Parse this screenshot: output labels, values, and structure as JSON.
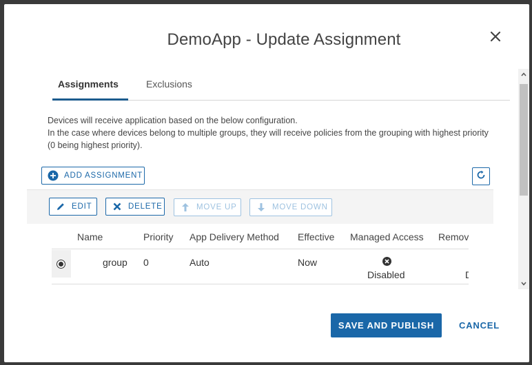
{
  "dialog": {
    "title": "DemoApp - Update Assignment"
  },
  "tabs": [
    {
      "label": "Assignments",
      "active": true
    },
    {
      "label": "Exclusions",
      "active": false
    }
  ],
  "description": {
    "line1": "Devices will receive application based on the below configuration.",
    "line2": "In the case where devices belong to multiple groups, they will receive policies from the grouping with highest priority (0 being highest priority)."
  },
  "toolbar": {
    "add_label": "ADD ASSIGNMENT",
    "edit_label": "EDIT",
    "delete_label": "DELETE",
    "move_up_label": "MOVE UP",
    "move_down_label": "MOVE DOWN"
  },
  "table": {
    "columns": [
      "Name",
      "Priority",
      "App Delivery Method",
      "Effective",
      "Managed Access",
      "Remov"
    ],
    "rows": [
      {
        "name": "group",
        "priority": "0",
        "delivery": "Auto",
        "effective": "Now",
        "managed_access": "Disabled",
        "removal": "D"
      }
    ]
  },
  "footer": {
    "primary_label": "SAVE AND PUBLISH",
    "cancel_label": "CANCEL"
  },
  "colors": {
    "accent": "#1a67a8",
    "tab_underline": "#1c5b8d"
  },
  "icons": {
    "close": "close-icon",
    "add": "plus-circle-icon",
    "refresh": "refresh-icon",
    "edit": "pencil-icon",
    "delete": "x-icon",
    "move_up": "arrow-up-icon",
    "move_down": "arrow-down-icon",
    "disabled_status": "x-circle-icon"
  }
}
